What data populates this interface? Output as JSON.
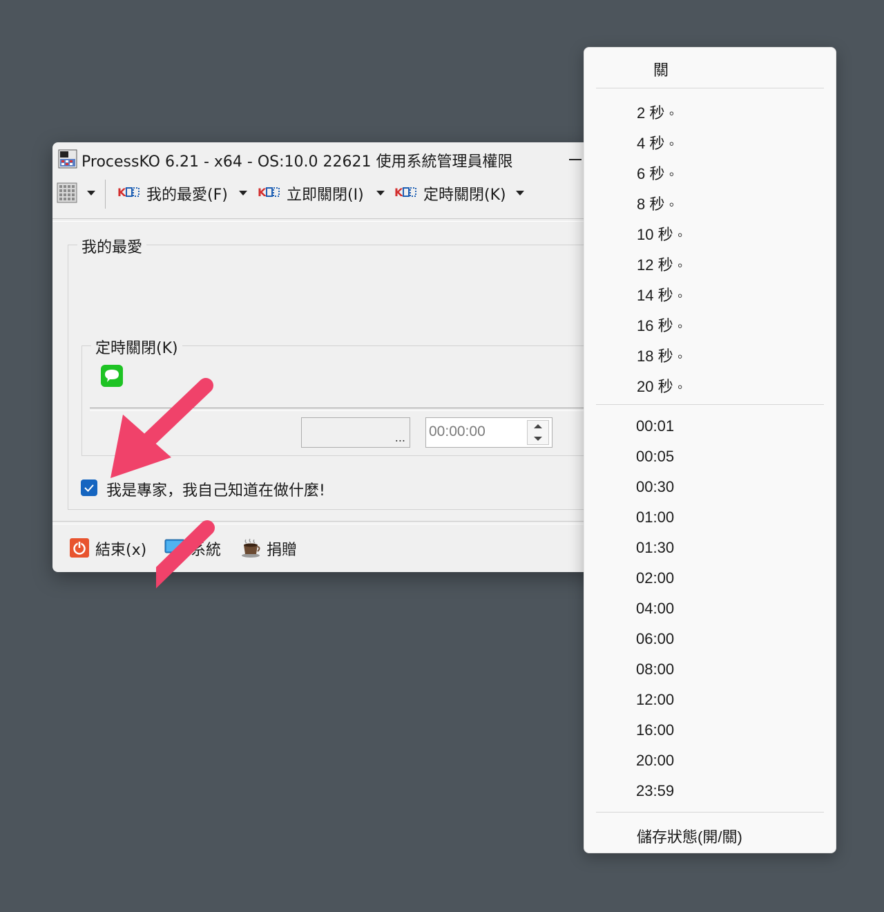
{
  "window": {
    "title": "ProcessKO 6.21 - x64  - OS:10.0 22621 使用系統管理員權限"
  },
  "toolbar": {
    "favorites_label": "我的最愛(F)",
    "kill_now_label": "立即關閉(I)",
    "timed_kill_label": "定時關閉(K)"
  },
  "favorites_group": {
    "label": "我的最愛"
  },
  "timed_group": {
    "label": "定時關閉(K)",
    "browse_label": "...",
    "time_value": "00:00:00"
  },
  "expert_checkbox": {
    "label": "我是專家，我自己知道在做什麼!",
    "checked": true
  },
  "bottom_bar": {
    "exit_label": "結束(x)",
    "system_label": "系統",
    "donate_label": "捐贈"
  },
  "menu": {
    "off_label": "關",
    "seconds_items": [
      "2 秒 ◦",
      "4 秒 ◦",
      "6 秒 ◦",
      "8 秒 ◦",
      "10 秒 ◦",
      "12 秒 ◦",
      "14 秒 ◦",
      "16 秒 ◦",
      "18 秒 ◦",
      "20 秒 ◦"
    ],
    "time_items": [
      "00:01",
      "00:05",
      "00:30",
      "01:00",
      "01:30",
      "02:00",
      "04:00",
      "06:00",
      "08:00",
      "12:00",
      "16:00",
      "20:00",
      "23:59"
    ],
    "save_state_label": "儲存狀態(開/關)"
  },
  "colors": {
    "background": "#4d555c",
    "window": "#f0f0f0",
    "checkbox_accent": "#1565c0",
    "annotation_arrow": "#f0426a",
    "ko_red": "#d32f2f",
    "ko_blue": "#1e5fb4"
  },
  "icons": {
    "app": "processko-app-icon",
    "minimize": "minimize-icon",
    "grid": "grid-view-icon",
    "ko": "ko-logo-icon",
    "message": "message-bubble-icon",
    "exit": "power-icon",
    "system": "monitor-icon",
    "donate": "coffee-cup-icon",
    "arrow": "annotation-arrow-icon"
  }
}
